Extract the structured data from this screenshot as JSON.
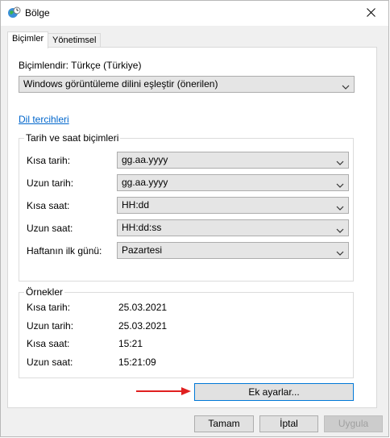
{
  "window": {
    "title": "Bölge",
    "close_symbol": "✕"
  },
  "tabs": [
    {
      "label": "Biçimler",
      "active": true
    },
    {
      "label": "Yönetimsel",
      "active": false
    }
  ],
  "format": {
    "label": "Biçimlendir: Türkçe (Türkiye)",
    "dropdown_value": "Windows görüntüleme dilini eşleştir (önerilen)"
  },
  "language_link": "Dil tercihleri",
  "date_time": {
    "group_title": "Tarih ve saat biçimleri",
    "rows": [
      {
        "label": "Kısa tarih:",
        "value": "gg.aa.yyyy"
      },
      {
        "label": "Uzun tarih:",
        "value": "gg.aa.yyyy"
      },
      {
        "label": "Kısa saat:",
        "value": "HH:dd"
      },
      {
        "label": "Uzun saat:",
        "value": "HH:dd:ss"
      },
      {
        "label": "Haftanın ilk günü:",
        "value": "Pazartesi"
      }
    ]
  },
  "examples": {
    "group_title": "Örnekler",
    "rows": [
      {
        "label": "Kısa tarih:",
        "value": "25.03.2021"
      },
      {
        "label": "Uzun tarih:",
        "value": "25.03.2021"
      },
      {
        "label": "Kısa saat:",
        "value": "15:21"
      },
      {
        "label": "Uzun saat:",
        "value": "15:21:09"
      }
    ]
  },
  "buttons": {
    "additional_settings": "Ek ayarlar...",
    "ok": "Tamam",
    "cancel": "İptal",
    "apply": "Uygula"
  },
  "colors": {
    "annotation_arrow": "#e02020",
    "link": "#0066cc",
    "focus_border": "#0078d7"
  },
  "icons": {
    "title_icon": "globe-clock-icon",
    "dropdown_icon": "chevron-down-icon",
    "close_icon": "close-icon"
  }
}
